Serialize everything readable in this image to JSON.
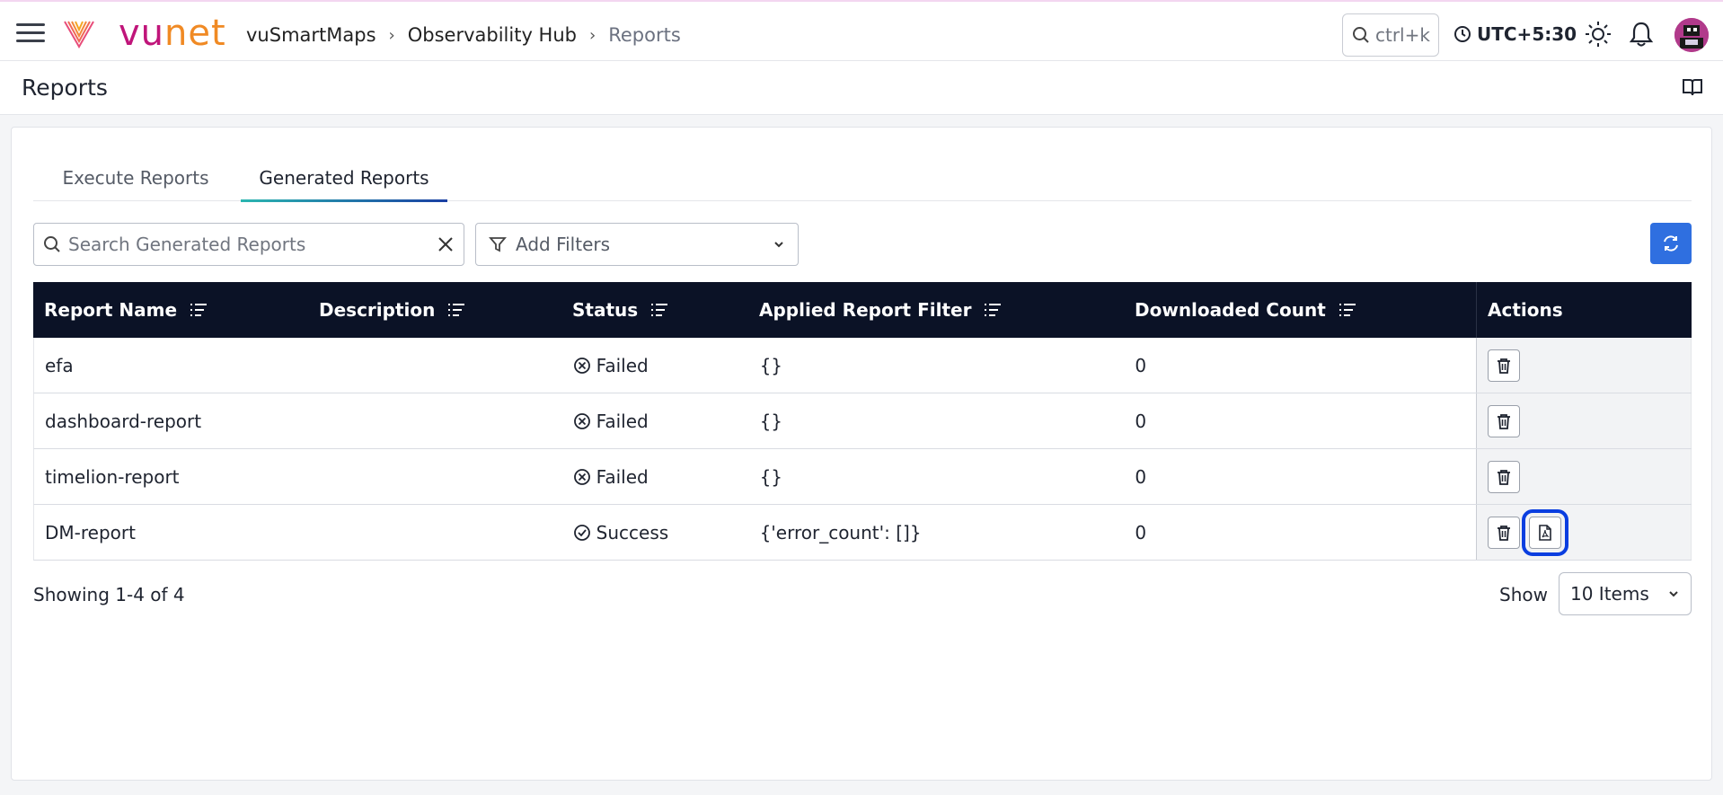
{
  "header": {
    "logo": {
      "part1": "vu",
      "part2": "net"
    },
    "breadcrumbs": [
      "vuSmartMaps",
      "Observability Hub",
      "Reports"
    ],
    "search_shortcut": "ctrl+k",
    "timezone": "UTC+5:30"
  },
  "page": {
    "title": "Reports"
  },
  "tabs": [
    {
      "label": "Execute Reports",
      "active": false
    },
    {
      "label": "Generated Reports",
      "active": true
    }
  ],
  "toolbar": {
    "search_placeholder": "Search Generated Reports",
    "filter_label": "Add Filters"
  },
  "table": {
    "columns": [
      "Report Name",
      "Description",
      "Status",
      "Applied Report Filter",
      "Downloaded Count",
      "Actions"
    ],
    "rows": [
      {
        "name": "efa",
        "description": "",
        "status": "Failed",
        "filter": "{}",
        "count": "0"
      },
      {
        "name": "dashboard-report",
        "description": "",
        "status": "Failed",
        "filter": "{}",
        "count": "0"
      },
      {
        "name": "timelion-report",
        "description": "",
        "status": "Failed",
        "filter": "{}",
        "count": "0"
      },
      {
        "name": "DM-report",
        "description": "",
        "status": "Success",
        "filter": "{'error_count': []}",
        "count": "0"
      }
    ]
  },
  "pagination": {
    "summary": "Showing 1-4 of 4",
    "show_label": "Show",
    "page_size": "10 Items"
  },
  "colors": {
    "accent": "#2f6fe0",
    "table_header": "#0b1226",
    "brand_vu": "#c0157a",
    "brand_net": "#f08a24",
    "highlight": "#0a3ee0"
  }
}
